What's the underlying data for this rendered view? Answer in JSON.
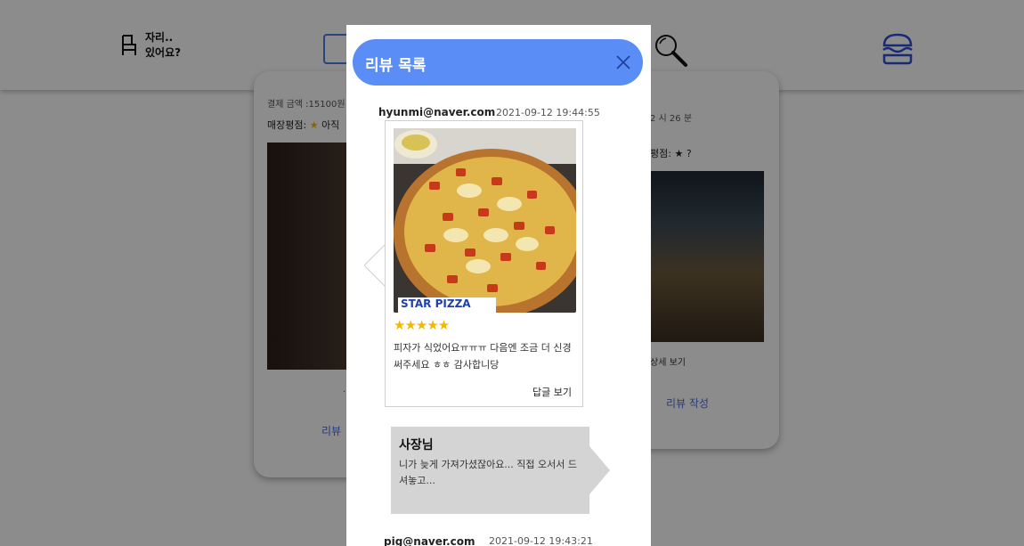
{
  "header": {
    "logo_line1": "자리..",
    "logo_line2": "있어요?",
    "icons": [
      "chair-icon",
      "search-icon",
      "hamburger-menu-icon"
    ]
  },
  "background_cards": {
    "left": {
      "pay": "결제 금액 :15100원",
      "rating_label": "매장평점:",
      "rating_value": "아직",
      "mid_text": "...",
      "review_link": "리뷰"
    },
    "right": {
      "time": "2 시 26 분",
      "rating_label": "평점:",
      "rating_value": "?",
      "detail_link": "상세 보기",
      "write_review": "리뷰 작성"
    }
  },
  "modal": {
    "title": "리뷰 목록",
    "accent": "#5a8df5",
    "reviews": [
      {
        "email": "hyunmi@naver.com",
        "date": "2021-09-12 19:44:55",
        "stars": "★★★★★",
        "rating": 5,
        "text": "피자가 식었어요ㅠㅠㅠ 다음엔 조금 더 신경 써주세요 ㅎㅎ 감사합니당",
        "photo_caption": "STAR PIZZA",
        "reply_toggle": "답글 보기",
        "owner_reply": {
          "name": "사장님",
          "text": "니가 늦게 가져가셨잖아요... 직접 오서서 드셔놓고..."
        }
      },
      {
        "email": "pig@naver.com",
        "date": "2021-09-12 19:43:21"
      }
    ]
  }
}
